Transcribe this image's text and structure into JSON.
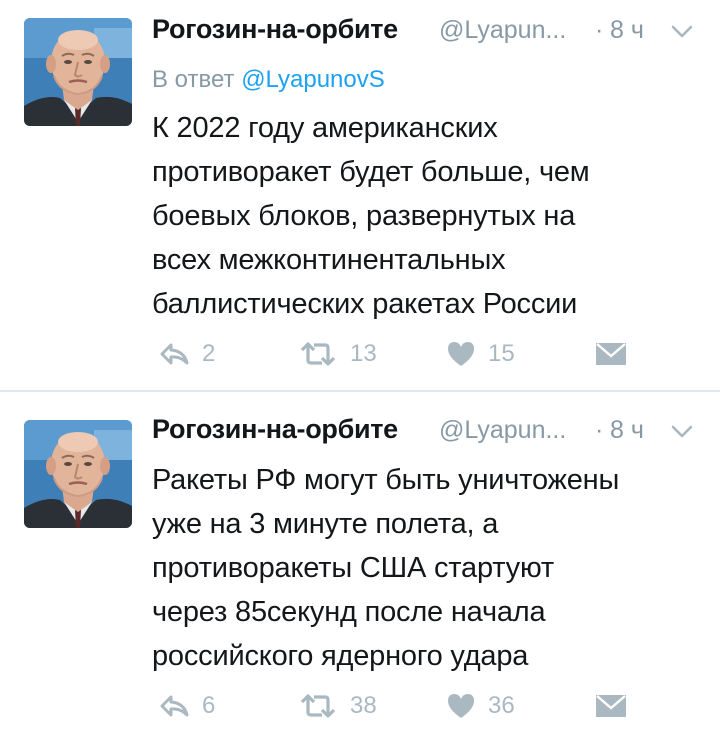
{
  "colors": {
    "text": "#14171a",
    "secondary": "#8899a6",
    "link": "#1da1f2",
    "action_gray": "#aab8c2",
    "divider": "#e1e8ed"
  },
  "tweets": [
    {
      "author_name": "Рогозин-на-орбите",
      "handle": "@Lyapun...",
      "separator": "·",
      "time": "8 ч",
      "reply_prefix": "В ответ",
      "reply_handle": "@LyapunovS",
      "text": "К 2022 году американских\nпротиворакет будет больше, чем\nбоевых блоков, развернутых на\nвсех межконтинентальных\nбаллистических ракетах России",
      "replies": "2",
      "retweets": "13",
      "likes": "15",
      "icons": {
        "reply": "reply-icon",
        "retweet": "retweet-icon",
        "like": "heart-icon",
        "dm": "envelope-icon",
        "menu": "chevron-down-icon"
      }
    },
    {
      "author_name": "Рогозин-на-орбите",
      "handle": "@Lyapun...",
      "separator": "·",
      "time": "8 ч",
      "text": "Ракеты РФ могут быть уничтожены\nуже на 3 минуте полета, а\nпротиворакеты США стартуют\nчерез 85секунд после начала\nроссийского ядерного удара",
      "replies": "6",
      "retweets": "38",
      "likes": "36",
      "icons": {
        "reply": "reply-icon",
        "retweet": "retweet-icon",
        "like": "heart-icon",
        "dm": "envelope-icon",
        "menu": "chevron-down-icon"
      }
    }
  ]
}
